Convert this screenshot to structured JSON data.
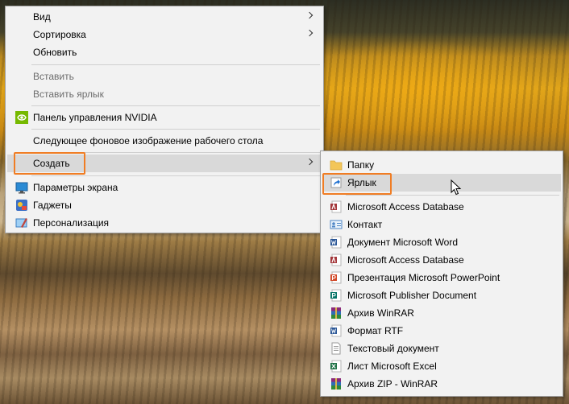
{
  "context_menu": {
    "items": [
      {
        "label": "Вид"
      },
      {
        "label": "Сортировка"
      },
      {
        "label": "Обновить"
      },
      {
        "label": "Вставить"
      },
      {
        "label": "Вставить ярлык"
      },
      {
        "label": "Панель управления NVIDIA"
      },
      {
        "label": "Следующее фоновое изображение рабочего стола"
      },
      {
        "label": "Создать"
      },
      {
        "label": "Параметры экрана"
      },
      {
        "label": "Гаджеты"
      },
      {
        "label": "Персонализация"
      }
    ]
  },
  "submenu": {
    "items": [
      {
        "label": "Папку"
      },
      {
        "label": "Ярлык"
      },
      {
        "label": "Microsoft Access Database"
      },
      {
        "label": "Контакт"
      },
      {
        "label": "Документ Microsoft Word"
      },
      {
        "label": "Microsoft Access Database"
      },
      {
        "label": "Презентация Microsoft PowerPoint"
      },
      {
        "label": "Microsoft Publisher Document"
      },
      {
        "label": "Архив WinRAR"
      },
      {
        "label": "Формат RTF"
      },
      {
        "label": "Текстовый документ"
      },
      {
        "label": "Лист Microsoft Excel"
      },
      {
        "label": "Архив ZIP - WinRAR"
      }
    ]
  },
  "colors": {
    "menu_background": "#f2f2f2",
    "highlight": "#d9d9d9",
    "annotation_box": "#f07d24",
    "disabled_text": "#6d6d6d"
  }
}
